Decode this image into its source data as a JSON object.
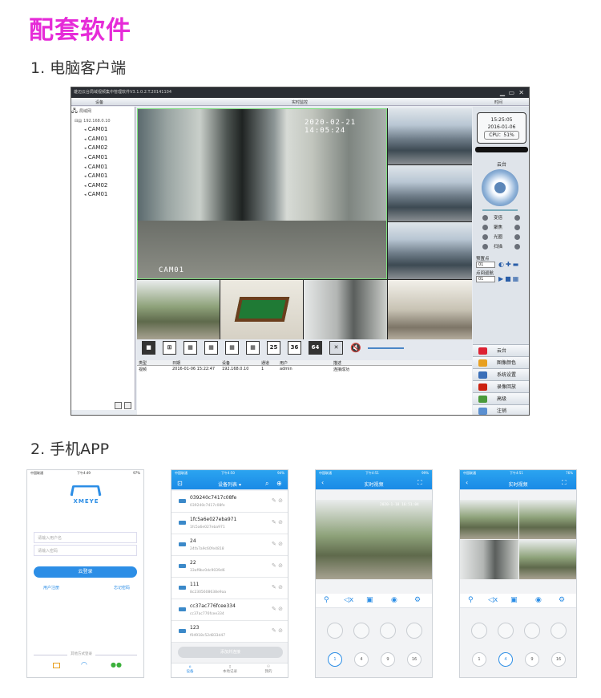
{
  "title": "配套软件",
  "section1": "1. 电脑客户端",
  "section2": "2. 手机APP",
  "pc": {
    "window_title": "雄迈云台局域视频集中管理软件V3.1.0.2.T.20141104",
    "menu": {
      "device": "设备",
      "monitor": "实时监控",
      "time": "时间"
    },
    "tree": {
      "root": "局域网",
      "node": "192.168.0.10",
      "cams": [
        "CAM01",
        "CAM01",
        "CAM02",
        "CAM01",
        "CAM01",
        "CAM01",
        "CAM02",
        "CAM01"
      ]
    },
    "osd_time": "2020-02-21 14:05:24",
    "osd_cam": "CAM01",
    "clock": {
      "time": "15:25:05",
      "date": "2016-01-06",
      "cpu": "CPU：51%"
    },
    "ptz_title": "云台",
    "ptz_rows": [
      "变倍",
      "聚焦",
      "光圈",
      "扫描"
    ],
    "preset_label": "预置点",
    "cruise_label": "点间巡航",
    "preset_value": "01",
    "cruise_value": "01",
    "layout_buttons": [
      "",
      "",
      "",
      "",
      "",
      "",
      "25",
      "36",
      "64"
    ],
    "log_headers": [
      "类型",
      "日期",
      "设备",
      "通道",
      "用户",
      "描述"
    ],
    "log_row": [
      "视频",
      "2016-01-06 15:22:47",
      "192.168.0.10",
      "1",
      "admin",
      "连接成功"
    ],
    "menu_buttons": [
      "云台",
      "图像颜色",
      "系统设置",
      "录像回放",
      "高级",
      "注销"
    ]
  },
  "phones": {
    "login": {
      "time": "下午4:49",
      "carrier": "中国联通",
      "battery": "97%",
      "brand": "XMEYE",
      "user_placeholder": "请输入用户名",
      "pass_placeholder": "请输入密码",
      "login_btn": "云登录",
      "register": "用户注册",
      "forgot": "忘记密码",
      "other": "其他方式登录"
    },
    "list": {
      "time": "下午4:50",
      "carrier": "中国联通",
      "battery": "94%",
      "header": "设备列表",
      "devices": [
        {
          "name": "039240c7417c08fe",
          "sn": "039240c7417c08fe"
        },
        {
          "name": "1fc5a6e027eba971",
          "sn": "1fc5a6e027eba971"
        },
        {
          "name": "24",
          "sn": "24fa7a9c60fe4818"
        },
        {
          "name": "22",
          "sn": "33af9bc0dc9039d6"
        },
        {
          "name": "111",
          "sn": "8c2305608638e9aa"
        },
        {
          "name": "cc37ac776fcee334",
          "sn": "cc37ac776fcee334"
        },
        {
          "name": "123",
          "sn": "f04918c52d833d47"
        }
      ],
      "add_btn": "添加并连接",
      "tabs": [
        "设备",
        "本地记录",
        "我的"
      ]
    },
    "live1": {
      "time": "下午4:51",
      "carrier": "中国联通",
      "battery": "99%",
      "header": "实时视频",
      "osd": "2020-1-18 16:51:04",
      "channels": [
        "1",
        "4",
        "9",
        "16"
      ],
      "selected": "1"
    },
    "live2": {
      "time": "下午4:51",
      "carrier": "中国联通",
      "battery": "76%",
      "header": "实时视频",
      "channels": [
        "1",
        "4",
        "9",
        "16"
      ],
      "selected": "4"
    }
  }
}
